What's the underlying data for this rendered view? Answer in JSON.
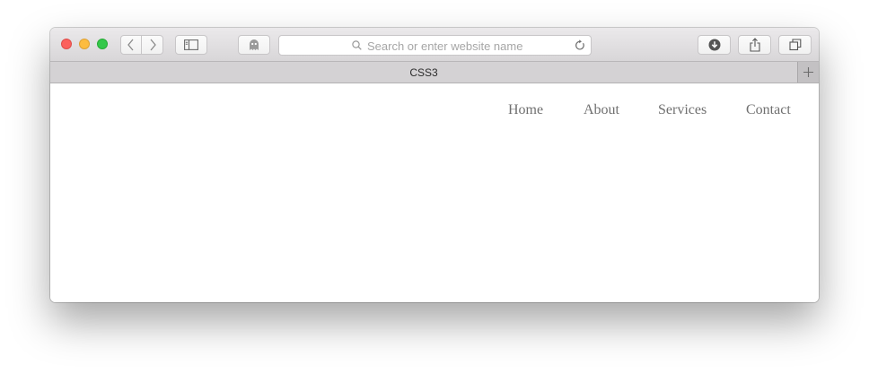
{
  "browser": {
    "address_placeholder": "Search or enter website name",
    "tab_title": "CSS3"
  },
  "icons": {
    "traffic_lights": [
      "close-icon",
      "minimize-icon",
      "zoom-icon"
    ],
    "toolbar": [
      "back-icon",
      "forward-icon",
      "sidebar-icon",
      "ghost-icon",
      "search-icon",
      "reload-icon",
      "download-icon",
      "share-icon",
      "tabs-icon",
      "plus-icon"
    ]
  },
  "colors": {
    "close": "#fc605c",
    "minimize": "#fdbc40",
    "zoom": "#34c84a",
    "nav_text": "#707070"
  },
  "page": {
    "nav": [
      {
        "label": "Home"
      },
      {
        "label": "About"
      },
      {
        "label": "Services"
      },
      {
        "label": "Contact"
      }
    ]
  }
}
